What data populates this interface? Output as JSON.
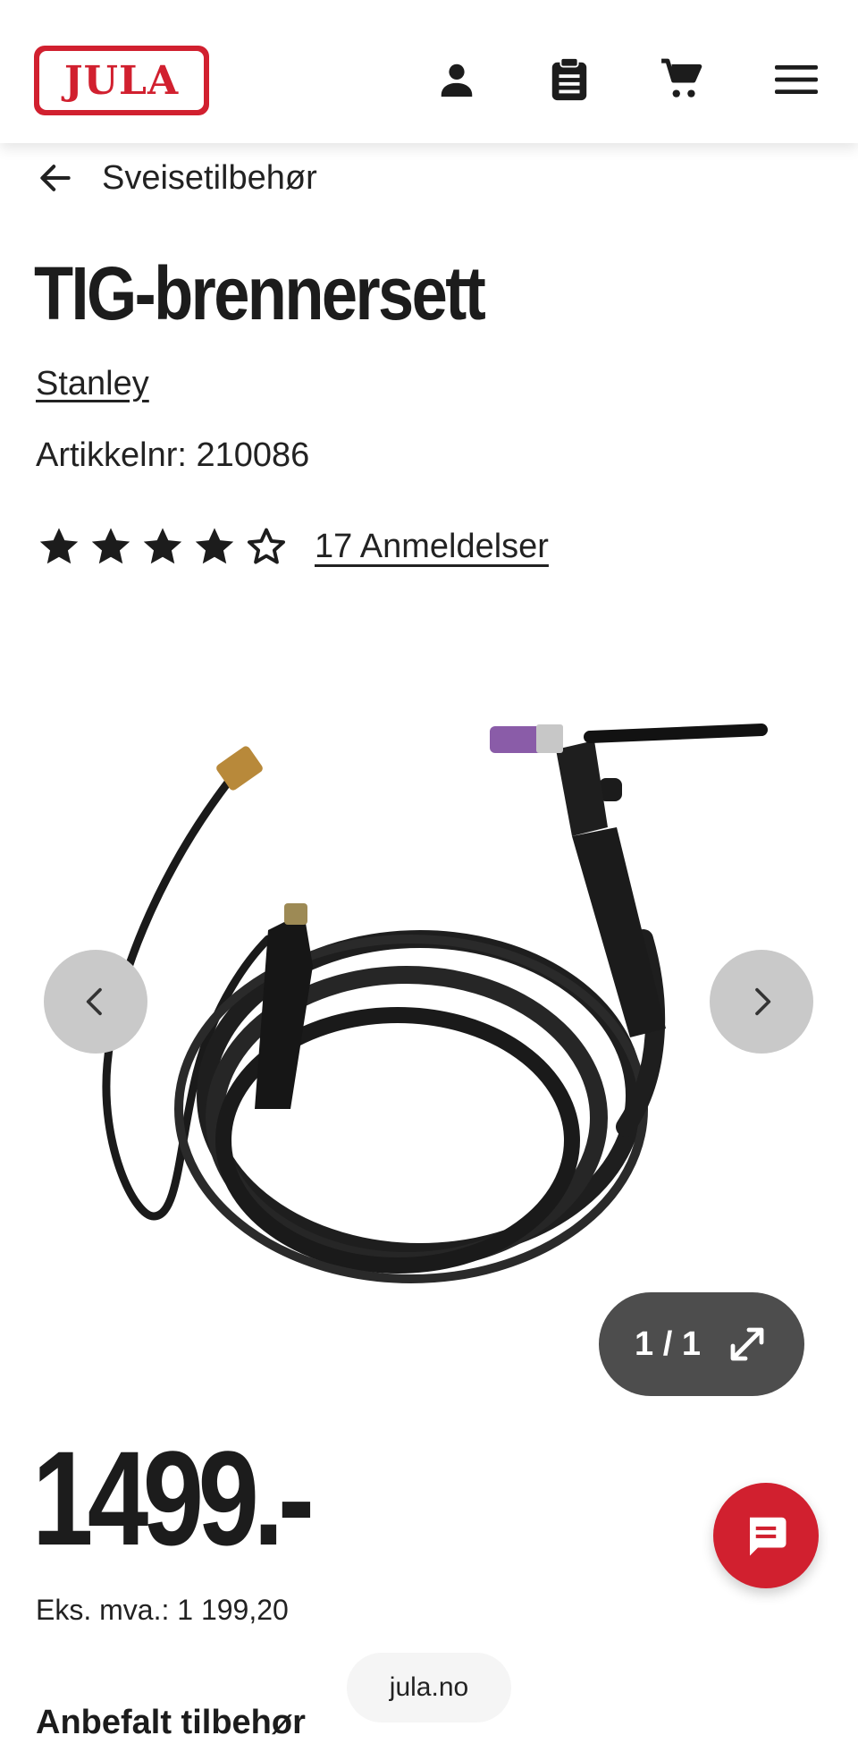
{
  "header": {
    "logo_text": "JULA",
    "icons": [
      "user-icon",
      "clipboard-icon",
      "cart-icon",
      "menu-icon"
    ]
  },
  "breadcrumb": {
    "label": "Sveisetilbehør"
  },
  "product": {
    "title": "TIG-brennersett",
    "brand": "Stanley",
    "article_number": "Artikkelnr: 210086",
    "rating": 4,
    "rating_max": 5,
    "reviews_label": "17 Anmeldelser",
    "image_counter": "1 / 1",
    "price": "1499.-",
    "price_ex_vat": "Eks. mva.: 1 199,20"
  },
  "browser": {
    "url": "jula.no"
  },
  "sections": {
    "recommended_title": "Anbefalt tilbehør"
  },
  "colors": {
    "brand_red": "#d1202f",
    "text": "#1f1f1f"
  }
}
